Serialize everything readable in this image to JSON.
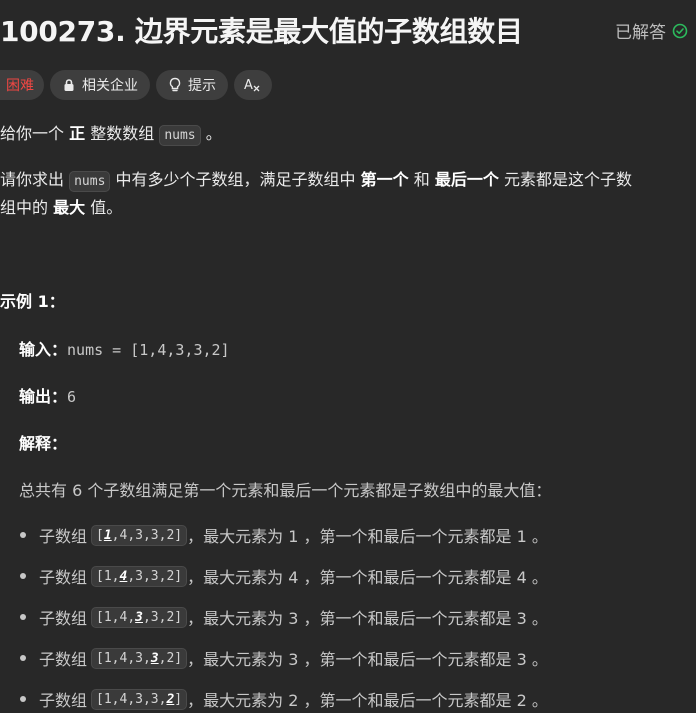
{
  "header": {
    "title": "100273. 边界元素是最大值的子数组数目",
    "status_label": "已解答",
    "status_color": "#2cbb5d"
  },
  "tags": [
    {
      "label": "困难",
      "icon": null
    },
    {
      "label": "相关企业",
      "icon": "lock-icon"
    },
    {
      "label": "提示",
      "icon": "lightbulb-icon"
    },
    {
      "label": "",
      "icon": "translate-icon"
    }
  ],
  "description": {
    "p1": {
      "before": "给你一个",
      "bold": "正",
      "middle": "整数数组",
      "code": "nums",
      "after": "。"
    },
    "p2": {
      "before": "请你求出",
      "code": "nums",
      "mid1": "中有多少个子数组，满足子数组中",
      "bold1": "第一个",
      "mid2": "和",
      "bold2": "最后一个",
      "after": "元素都是这个子数",
      "line2_before": "组中的",
      "bold3": "最大",
      "line2_after": "值。"
    }
  },
  "example": {
    "title": "示例 1：",
    "input_label": "输入：",
    "input_value": "nums = [1,4,3,3,2]",
    "output_label": "输出：",
    "output_value": "6",
    "explain_label": "解释：",
    "explain_text": "总共有 6 个子数组满足第一个元素和最后一个元素都是子数组中的最大值：",
    "items": [
      {
        "prefix": "子数组",
        "code_pre": "[",
        "code_hl": "1",
        "code_post": ",4,3,3,2]",
        "text": "，最大元素为 1 ，第一个和最后一个元素都是 1 。"
      },
      {
        "prefix": "子数组",
        "code_pre": "[1,",
        "code_hl": "4",
        "code_post": ",3,3,2]",
        "text": "，最大元素为 4 ，第一个和最后一个元素都是 4 。"
      },
      {
        "prefix": "子数组",
        "code_pre": "[1,4,",
        "code_hl": "3",
        "code_post": ",3,2]",
        "text": "，最大元素为 3 ，第一个和最后一个元素都是 3 。"
      },
      {
        "prefix": "子数组",
        "code_pre": "[1,4,3,",
        "code_hl": "3",
        "code_post": ",2]",
        "text": "，最大元素为 3 ，第一个和最后一个元素都是 3 。"
      },
      {
        "prefix": "子数组",
        "code_pre": "[1,4,3,3,",
        "code_hl": "2",
        "code_post": "]",
        "text": "，最大元素为 2 ，第一个和最后一个元素都是 2 。"
      }
    ]
  }
}
